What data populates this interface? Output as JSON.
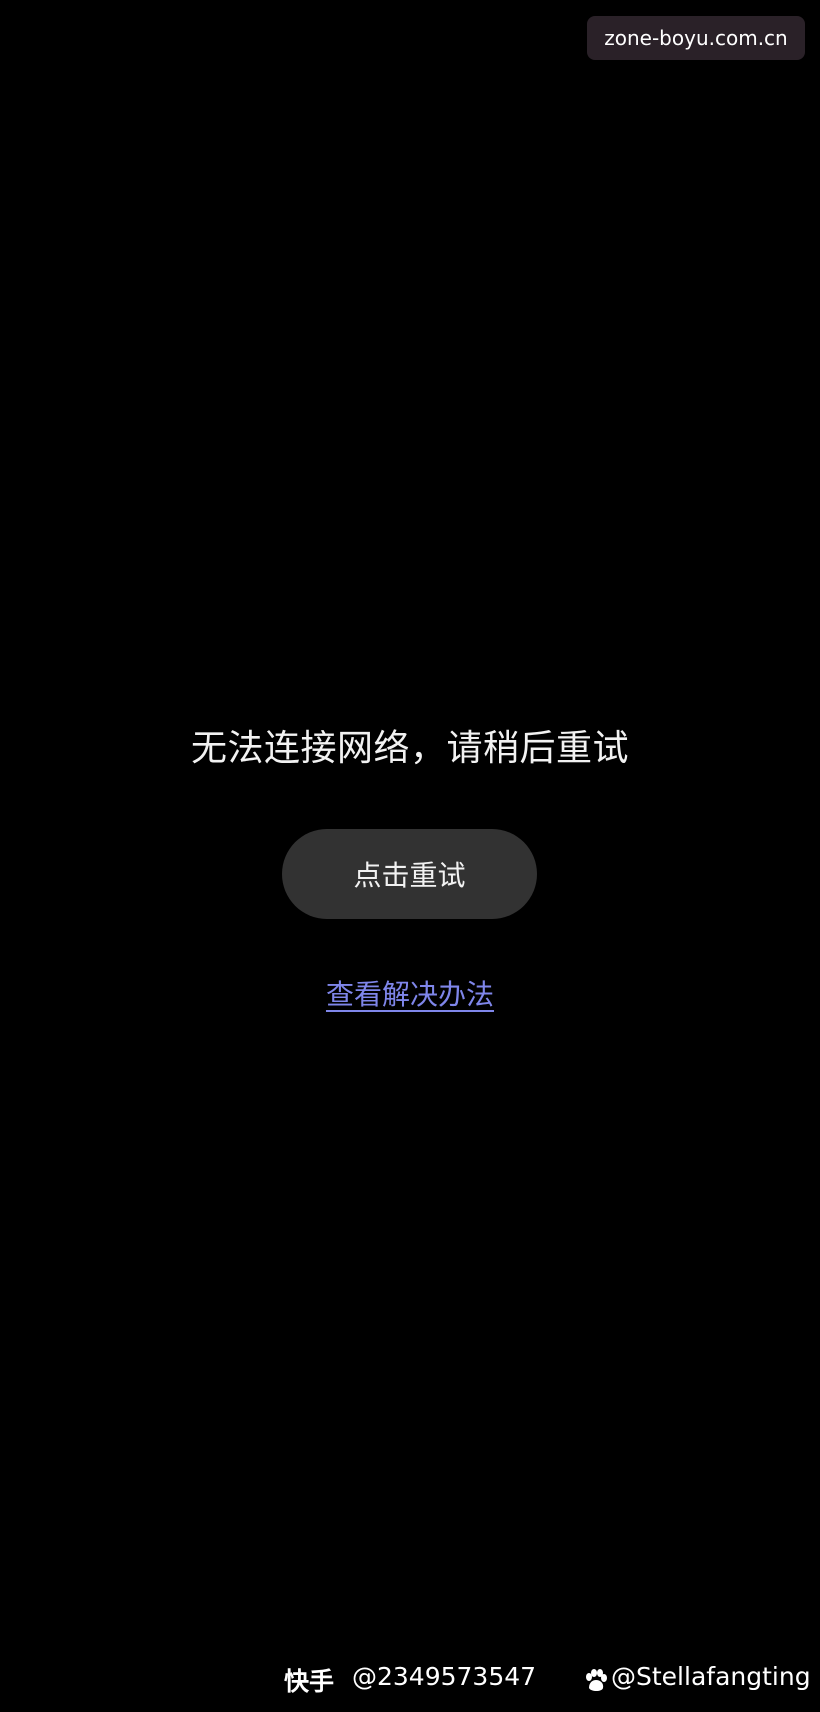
{
  "watermark": {
    "text": "zone-boyu.com.cn"
  },
  "error": {
    "message": "无法连接网络，请稍后重试"
  },
  "retry_button": {
    "label": "点击重试"
  },
  "solution_link": {
    "label": "查看解决办法"
  },
  "footer": {
    "brand": "快手",
    "id": "@2349573547",
    "paw_icon": "paw-icon",
    "handle": "@Stellafangting"
  },
  "colors": {
    "background": "#000000",
    "button_bg": "#323232",
    "link": "#7f86ea",
    "watermark_bg": "#2a2128"
  }
}
